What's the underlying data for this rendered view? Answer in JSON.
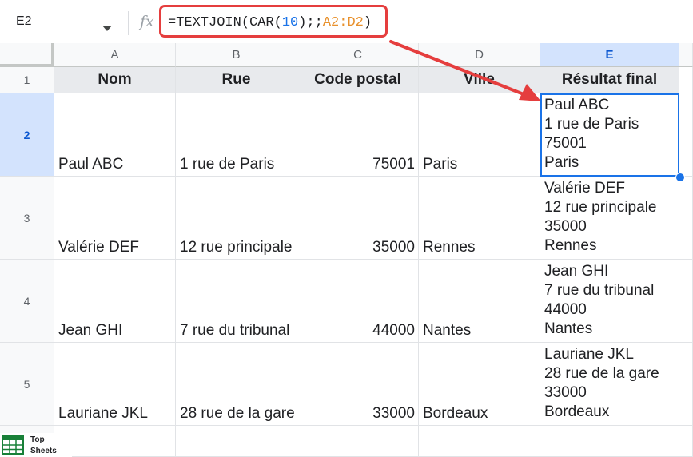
{
  "formula_bar": {
    "name_box": "E2",
    "fx_label": "fx",
    "formula": {
      "prefix": "=TEXTJOIN(CAR(",
      "arg_number": "10",
      "middle": ");;",
      "arg_range": "A2:D2",
      "suffix": ")"
    }
  },
  "columns": [
    "A",
    "B",
    "C",
    "D",
    "E"
  ],
  "selected_column": "E",
  "rows": [
    "1",
    "2",
    "3",
    "4",
    "5"
  ],
  "selected_row": "2",
  "header_row": [
    "Nom",
    "Rue",
    "Code postal",
    "Ville",
    "Résultat final"
  ],
  "data_rows": [
    {
      "nom": "Paul ABC",
      "rue": "1 rue de Paris",
      "code": "75001",
      "ville": "Paris",
      "result": [
        "Paul ABC",
        "1 rue de Paris",
        "75001",
        "Paris"
      ]
    },
    {
      "nom": "Valérie DEF",
      "rue": "12 rue principale",
      "code": "35000",
      "ville": "Rennes",
      "result": [
        "Valérie DEF",
        "12 rue principale",
        "35000",
        "Rennes"
      ]
    },
    {
      "nom": "Jean GHI",
      "rue": "7 rue du tribunal",
      "code": "44000",
      "ville": "Nantes",
      "result": [
        "Jean GHI",
        "7 rue du tribunal",
        "44000",
        "Nantes"
      ]
    },
    {
      "nom": "Lauriane JKL",
      "rue": "28 rue de la gare",
      "code": "33000",
      "ville": "Bordeaux",
      "result": [
        "Lauriane JKL",
        "28 rue de la gare",
        "33000",
        "Bordeaux"
      ]
    }
  ],
  "logo": {
    "line1": "Top",
    "line2": "Sheets"
  },
  "colors": {
    "highlight": "#e53e3e",
    "selection": "#1a73e8",
    "range_ref": "#e8912d",
    "number_ref": "#1a73e8"
  }
}
